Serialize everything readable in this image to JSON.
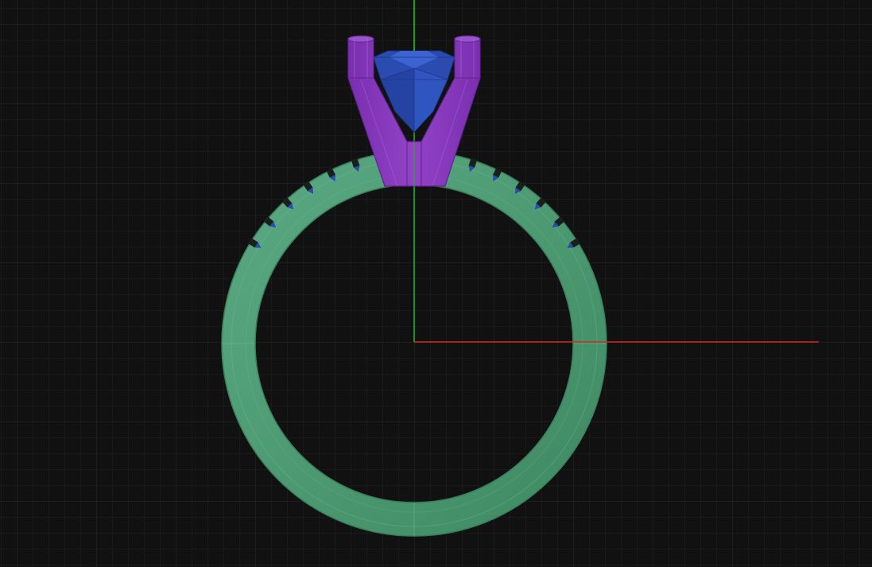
{
  "viewport": {
    "view": "front",
    "background_color": "#111111",
    "grid": {
      "visible": true,
      "minor_color": "#1f2321",
      "major_color": "#262b29"
    },
    "axes": {
      "x_axis_color": "#d42a22",
      "y_axis_color": "#21b321"
    }
  },
  "model": {
    "objects": [
      {
        "name": "ring-shank",
        "color": "#4a9a70"
      },
      {
        "name": "prong-head",
        "color": "#8434b4"
      },
      {
        "name": "center-stone",
        "color": "#2a4bb0"
      },
      {
        "name": "pave-accent-stones",
        "color": "#2a4bb0"
      }
    ]
  }
}
